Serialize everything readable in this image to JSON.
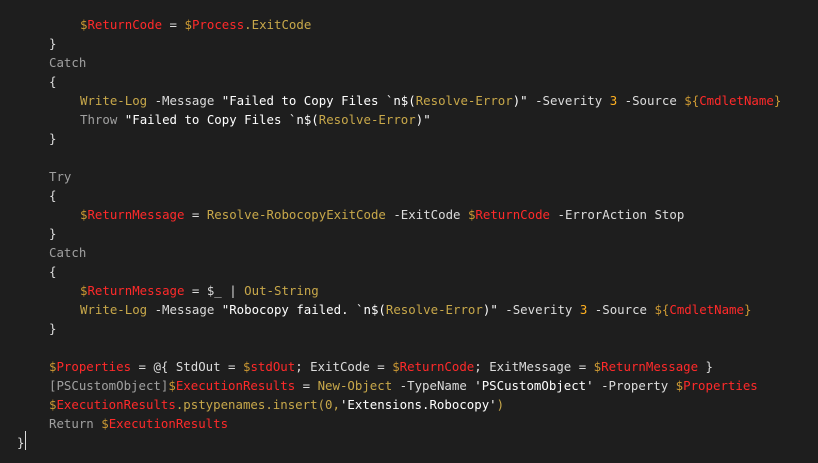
{
  "palette": {
    "background": "#1e1e1e",
    "plain": "#dcdcdc",
    "keyword": "#a0a0a0",
    "variable": "#ff2a2a",
    "dollar": "#cc9933",
    "command": "#c8a84a",
    "string": "#ffffff",
    "number": "#ffb020"
  },
  "lines": [
    {
      "indent": 3,
      "tokens": [
        [
          "$",
          "dollar"
        ],
        [
          "ReturnCode",
          "variable"
        ],
        [
          " = ",
          "plain"
        ],
        [
          "$",
          "dollar"
        ],
        [
          "Process",
          "variable"
        ],
        [
          ".ExitCode",
          "command"
        ]
      ]
    },
    {
      "indent": 2,
      "tokens": [
        [
          "}",
          "plain"
        ]
      ]
    },
    {
      "indent": 2,
      "tokens": [
        [
          "Catch",
          "keyword"
        ]
      ]
    },
    {
      "indent": 2,
      "tokens": [
        [
          "{",
          "plain"
        ]
      ]
    },
    {
      "indent": 3,
      "tokens": [
        [
          "Write-Log",
          "command"
        ],
        [
          " -Message ",
          "plain"
        ],
        [
          "\"Failed to Copy Files `n$(",
          "string"
        ],
        [
          "Resolve-Error",
          "command"
        ],
        [
          ")\"",
          "string"
        ],
        [
          " -Severity ",
          "plain"
        ],
        [
          "3",
          "number"
        ],
        [
          " -Source ",
          "plain"
        ],
        [
          "${",
          "dollar"
        ],
        [
          "CmdletName",
          "variable"
        ],
        [
          "}",
          "dollar"
        ]
      ]
    },
    {
      "indent": 3,
      "tokens": [
        [
          "Throw",
          "keyword"
        ],
        [
          " ",
          "plain"
        ],
        [
          "\"Failed to Copy Files `n$(",
          "string"
        ],
        [
          "Resolve-Error",
          "command"
        ],
        [
          ")\"",
          "string"
        ]
      ]
    },
    {
      "indent": 2,
      "tokens": [
        [
          "}",
          "plain"
        ]
      ]
    },
    {
      "indent": 0,
      "tokens": []
    },
    {
      "indent": 2,
      "tokens": [
        [
          "Try",
          "keyword"
        ]
      ]
    },
    {
      "indent": 2,
      "tokens": [
        [
          "{",
          "plain"
        ]
      ]
    },
    {
      "indent": 3,
      "tokens": [
        [
          "$",
          "dollar"
        ],
        [
          "ReturnMessage",
          "variable"
        ],
        [
          " = ",
          "plain"
        ],
        [
          "Resolve-RobocopyExitCode",
          "command"
        ],
        [
          " -ExitCode ",
          "plain"
        ],
        [
          "$",
          "dollar"
        ],
        [
          "ReturnCode",
          "variable"
        ],
        [
          " -ErrorAction Stop",
          "plain"
        ]
      ]
    },
    {
      "indent": 2,
      "tokens": [
        [
          "}",
          "plain"
        ]
      ]
    },
    {
      "indent": 2,
      "tokens": [
        [
          "Catch",
          "keyword"
        ]
      ]
    },
    {
      "indent": 2,
      "tokens": [
        [
          "{",
          "plain"
        ]
      ]
    },
    {
      "indent": 3,
      "tokens": [
        [
          "$",
          "dollar"
        ],
        [
          "ReturnMessage",
          "variable"
        ],
        [
          " = ",
          "plain"
        ],
        [
          "$_",
          "plain"
        ],
        [
          " | ",
          "plain"
        ],
        [
          "Out-String",
          "command"
        ]
      ]
    },
    {
      "indent": 3,
      "tokens": [
        [
          "Write-Log",
          "command"
        ],
        [
          " -Message ",
          "plain"
        ],
        [
          "\"Robocopy failed. `n$(",
          "string"
        ],
        [
          "Resolve-Error",
          "command"
        ],
        [
          ")\"",
          "string"
        ],
        [
          " -Severity ",
          "plain"
        ],
        [
          "3",
          "number"
        ],
        [
          " -Source ",
          "plain"
        ],
        [
          "${",
          "dollar"
        ],
        [
          "CmdletName",
          "variable"
        ],
        [
          "}",
          "dollar"
        ]
      ]
    },
    {
      "indent": 2,
      "tokens": [
        [
          "}",
          "plain"
        ]
      ]
    },
    {
      "indent": 0,
      "tokens": []
    },
    {
      "indent": 2,
      "tokens": [
        [
          "$",
          "dollar"
        ],
        [
          "Properties",
          "variable"
        ],
        [
          " = @{ StdOut = ",
          "plain"
        ],
        [
          "$",
          "dollar"
        ],
        [
          "stdOut",
          "variable"
        ],
        [
          "; ExitCode = ",
          "plain"
        ],
        [
          "$",
          "dollar"
        ],
        [
          "ReturnCode",
          "variable"
        ],
        [
          "; ExitMessage = ",
          "plain"
        ],
        [
          "$",
          "dollar"
        ],
        [
          "ReturnMessage",
          "variable"
        ],
        [
          " }",
          "plain"
        ]
      ]
    },
    {
      "indent": 2,
      "tokens": [
        [
          "[PSCustomObject]",
          "keyword"
        ],
        [
          "$",
          "dollar"
        ],
        [
          "ExecutionResults",
          "variable"
        ],
        [
          " = ",
          "plain"
        ],
        [
          "New-Object",
          "command"
        ],
        [
          " -TypeName ",
          "plain"
        ],
        [
          "'PSCustomObject'",
          "string"
        ],
        [
          " -Property ",
          "plain"
        ],
        [
          "$",
          "dollar"
        ],
        [
          "Properties",
          "variable"
        ]
      ]
    },
    {
      "indent": 2,
      "tokens": [
        [
          "$",
          "dollar"
        ],
        [
          "ExecutionResults",
          "variable"
        ],
        [
          ".pstypenames.insert(0,",
          "command"
        ],
        [
          "'Extensions.Robocopy'",
          "string"
        ],
        [
          ")",
          "command"
        ]
      ]
    },
    {
      "indent": 2,
      "tokens": [
        [
          "Return ",
          "keyword"
        ],
        [
          "$",
          "dollar"
        ],
        [
          "ExecutionResults",
          "variable"
        ]
      ]
    },
    {
      "indent": 1,
      "tokens": [
        [
          "}",
          "plain"
        ]
      ]
    }
  ]
}
